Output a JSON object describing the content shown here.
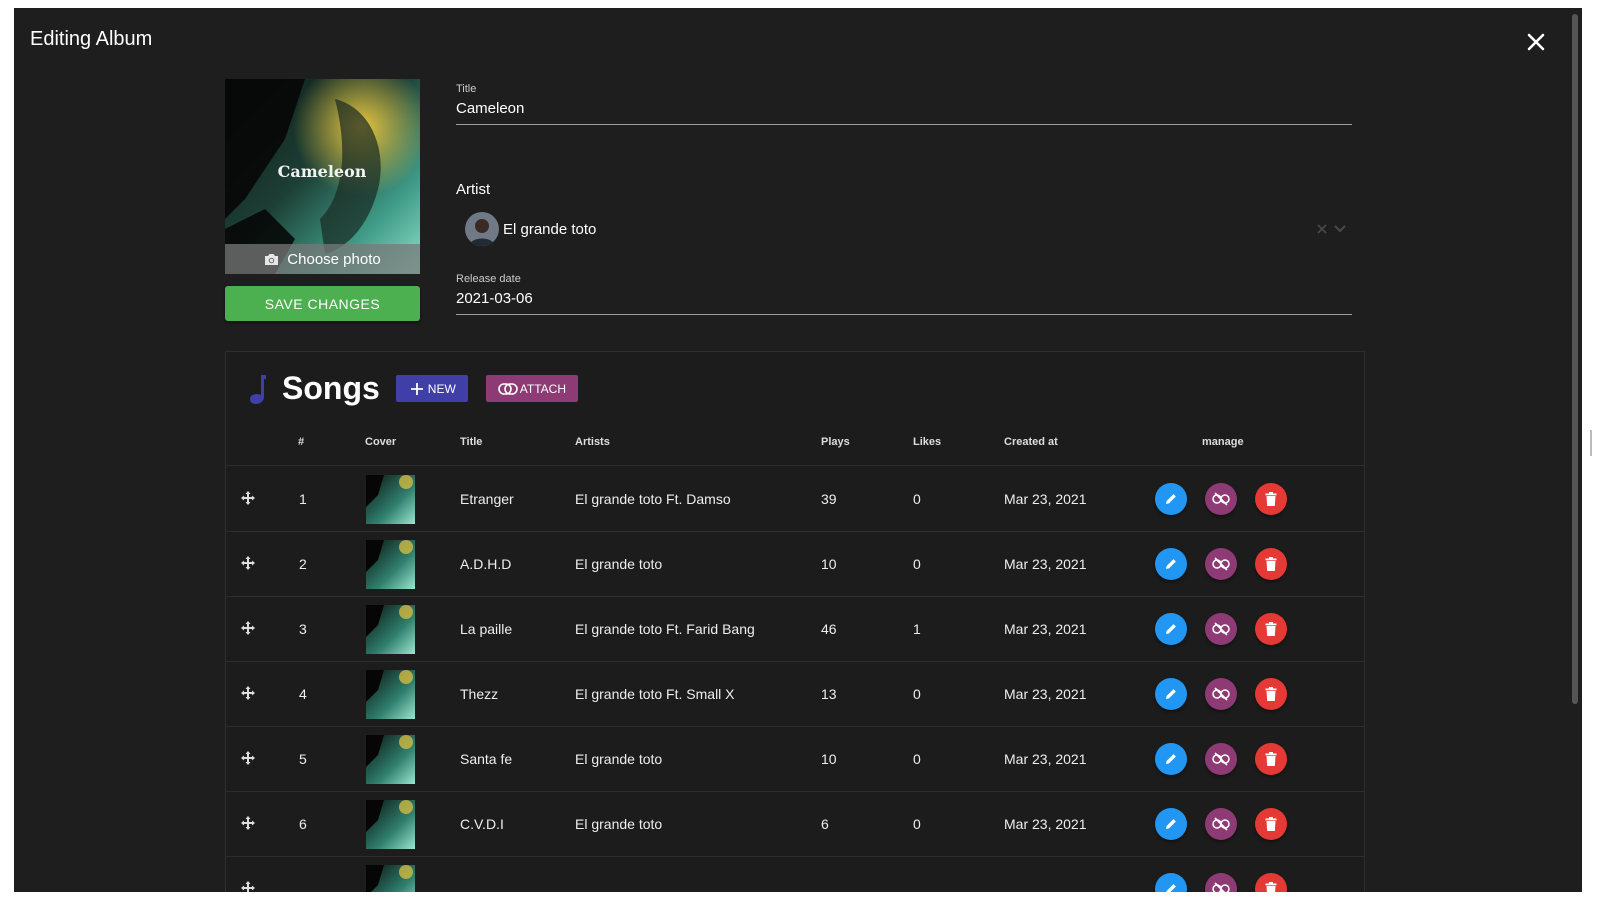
{
  "dialog": {
    "title": "Editing Album",
    "close_icon": "close-icon"
  },
  "cover": {
    "art_title": "Cameleon",
    "choose_photo_label": "Choose photo",
    "camera_icon": "camera-icon"
  },
  "save_label": "SAVE CHANGES",
  "fields": {
    "title_label": "Title",
    "title_value": "Cameleon",
    "artist_label": "Artist",
    "artist_value": "El grande toto",
    "release_label": "Release date",
    "release_value": "2021-03-06"
  },
  "songs": {
    "title": "Songs",
    "new_label": "NEW",
    "attach_label": "ATTACH",
    "columns": {
      "num": "#",
      "cover": "Cover",
      "title": "Title",
      "artists": "Artists",
      "plays": "Plays",
      "likes": "Likes",
      "created": "Created at",
      "manage": "manage"
    },
    "rows": [
      {
        "num": "1",
        "title": "Etranger",
        "artists": "El grande toto Ft. Damso",
        "plays": "39",
        "likes": "0",
        "created": "Mar 23, 2021"
      },
      {
        "num": "2",
        "title": "A.D.H.D",
        "artists": "El grande toto",
        "plays": "10",
        "likes": "0",
        "created": "Mar 23, 2021"
      },
      {
        "num": "3",
        "title": "La paille",
        "artists": "El grande toto Ft. Farid Bang",
        "plays": "46",
        "likes": "1",
        "created": "Mar 23, 2021"
      },
      {
        "num": "4",
        "title": "Thezz",
        "artists": "El grande toto Ft. Small X",
        "plays": "13",
        "likes": "0",
        "created": "Mar 23, 2021"
      },
      {
        "num": "5",
        "title": "Santa fe",
        "artists": "El grande toto",
        "plays": "10",
        "likes": "0",
        "created": "Mar 23, 2021"
      },
      {
        "num": "6",
        "title": "C.V.D.I",
        "artists": "El grande toto",
        "plays": "6",
        "likes": "0",
        "created": "Mar 23, 2021"
      },
      {
        "num": "",
        "title": "",
        "artists": "",
        "plays": "",
        "likes": "",
        "created": ""
      }
    ]
  },
  "colors": {
    "save": "#4caf50",
    "new": "#3f3fa7",
    "attach": "#8e3a74",
    "edit": "#2196f3",
    "detach": "#8e3a74",
    "delete": "#e53935"
  }
}
